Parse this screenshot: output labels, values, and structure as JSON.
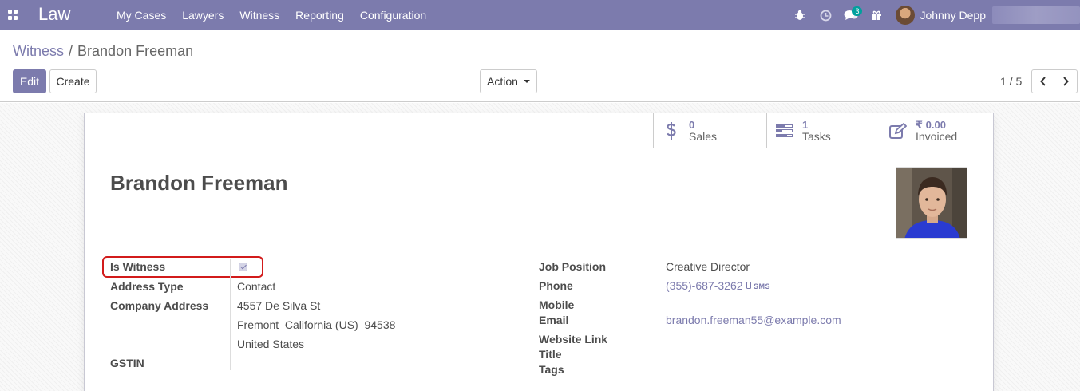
{
  "navbar": {
    "brand": "Law",
    "menu": [
      "My Cases",
      "Lawyers",
      "Witness",
      "Reporting",
      "Configuration"
    ],
    "messages_count": "3",
    "user_name": "Johnny Depp"
  },
  "breadcrumb": {
    "parent": "Witness",
    "separator": "/",
    "current": "Brandon Freeman"
  },
  "toolbar": {
    "edit": "Edit",
    "create": "Create",
    "action": "Action"
  },
  "pager": {
    "value": "1 / 5"
  },
  "smart_buttons": [
    {
      "value": "0",
      "label": "Sales",
      "icon": "dollar-icon"
    },
    {
      "value": "1",
      "label": "Tasks",
      "icon": "tasks-icon"
    },
    {
      "value": "₹ 0.00",
      "label": "Invoiced",
      "icon": "invoice-icon"
    }
  ],
  "record": {
    "name": "Brandon Freeman",
    "is_witness": true
  },
  "labels": {
    "is_witness": "Is Witness",
    "address_type": "Address Type",
    "company_address": "Company Address",
    "gstin": "GSTIN",
    "job_position": "Job Position",
    "phone": "Phone",
    "mobile": "Mobile",
    "email": "Email",
    "website": "Website Link",
    "title": "Title",
    "tags": "Tags"
  },
  "values": {
    "address_type": "Contact",
    "street": "4557 De Silva St",
    "city_line": "Fremont  California (US)  94538",
    "country": "United States",
    "job_position": "Creative Director",
    "phone": "(355)-687-3262",
    "sms": "SMS",
    "email": "brandon.freeman55@example.com"
  },
  "colors": {
    "brand": "#7c7bad",
    "highlight": "#d21b1b"
  }
}
